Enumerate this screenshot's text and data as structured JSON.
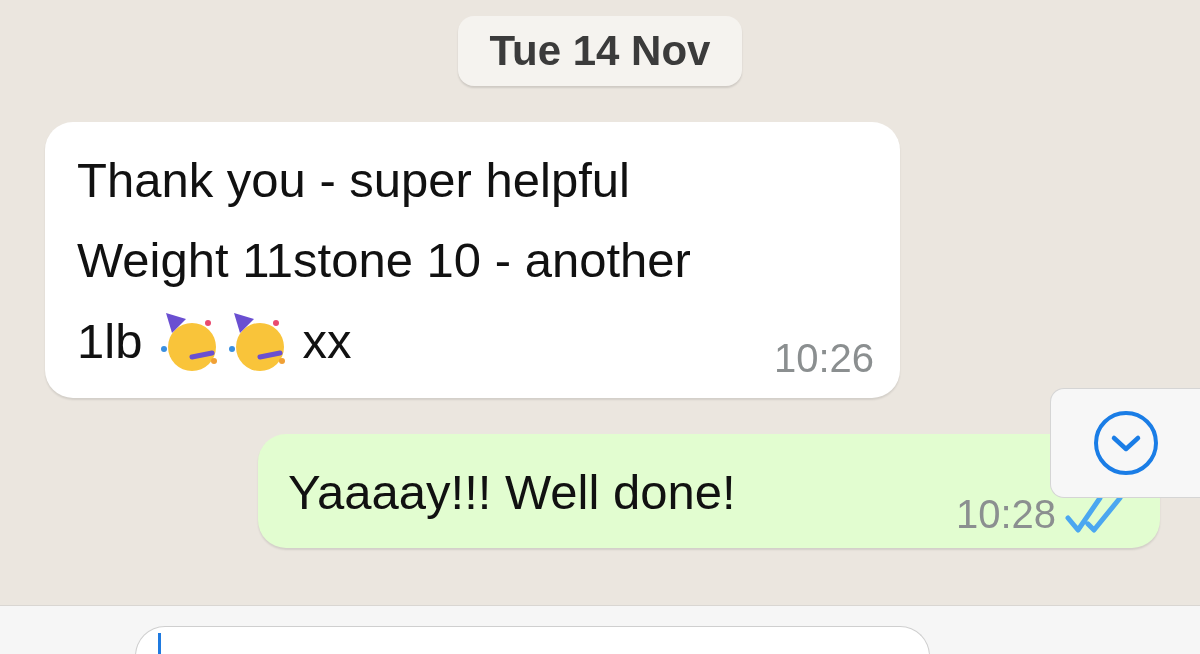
{
  "date_chip": "Tue 14 Nov",
  "messages": [
    {
      "kind": "incoming",
      "lines": [
        "Thank you - super helpful",
        "Weight 11stone 10 - another"
      ],
      "tail": [
        {
          "kind": "text",
          "text": "1lb"
        },
        {
          "kind": "emoji"
        },
        {
          "kind": "emoji"
        },
        {
          "kind": "text",
          "text": "xx"
        }
      ],
      "time": "10:26"
    },
    {
      "kind": "outgoing",
      "lines": [
        "Yaaaay!!! Well done!"
      ],
      "time": "10:28",
      "read": true
    }
  ]
}
